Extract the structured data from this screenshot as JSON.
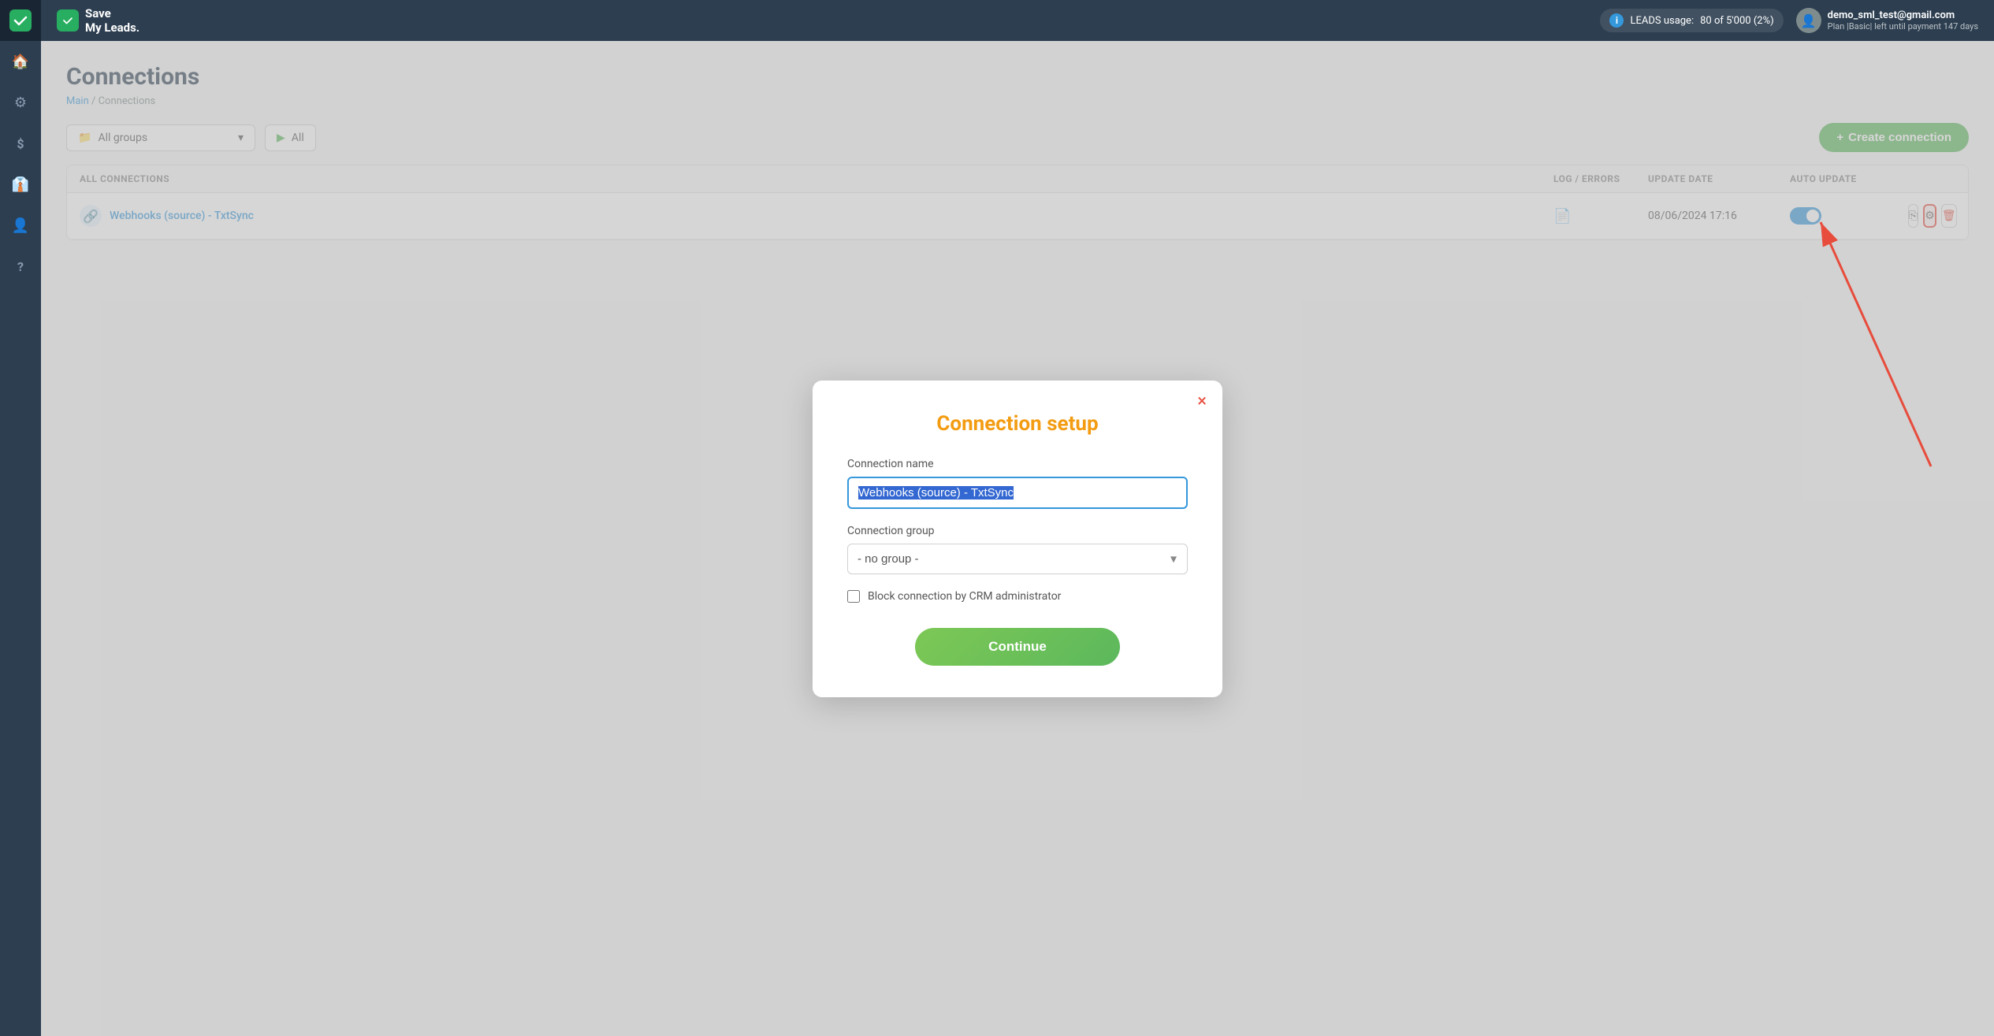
{
  "brand": {
    "name": "Save\nMy Leads.",
    "logo_alt": "SaveMyLeads logo"
  },
  "topbar": {
    "menu_icon": "☰",
    "leads_usage_label": "LEADS usage:",
    "leads_usage_value": "80 of 5'000 (2%)",
    "user_email": "demo_sml_test@gmail.com",
    "user_plan": "Plan |Basic| left until payment 147 days",
    "info_icon": "ℹ",
    "user_icon": "👤"
  },
  "sidebar": {
    "items": [
      {
        "id": "home",
        "icon": "🏠",
        "label": "Home"
      },
      {
        "id": "integrations",
        "icon": "⚙",
        "label": "Integrations"
      },
      {
        "id": "billing",
        "icon": "$",
        "label": "Billing"
      },
      {
        "id": "clients",
        "icon": "👔",
        "label": "Clients"
      },
      {
        "id": "profile",
        "icon": "👤",
        "label": "Profile"
      },
      {
        "id": "help",
        "icon": "?",
        "label": "Help"
      }
    ]
  },
  "page": {
    "title": "Connections",
    "breadcrumb_main": "Main",
    "breadcrumb_separator": "/",
    "breadcrumb_current": "Connections"
  },
  "toolbar": {
    "group_label": "All groups",
    "status_label": "All",
    "create_connection_label": "Create connection",
    "create_icon": "+"
  },
  "table": {
    "headers": {
      "all_connections": "ALL CONNECTIONS",
      "log_errors": "LOG / ERRORS",
      "update_date": "UPDATE DATE",
      "auto_update": "AUTO UPDATE"
    },
    "rows": [
      {
        "name": "Webhooks (source) - TxtSync",
        "icon": "🔗",
        "log": "📄",
        "update_date": "08/06/2024 17:16",
        "auto_update": true,
        "actions": [
          "copy",
          "settings",
          "delete"
        ]
      }
    ]
  },
  "modal": {
    "title": "Connection setup",
    "close_label": "×",
    "connection_name_label": "Connection name",
    "connection_name_value": "Webhooks (source) - TxtSync",
    "connection_group_label": "Connection group",
    "connection_group_value": "- no group -",
    "connection_group_options": [
      "- no group -"
    ],
    "block_connection_label": "Block connection by CRM administrator",
    "block_connection_checked": false,
    "continue_label": "Continue"
  },
  "arrow": {
    "color": "#e74c3c"
  }
}
